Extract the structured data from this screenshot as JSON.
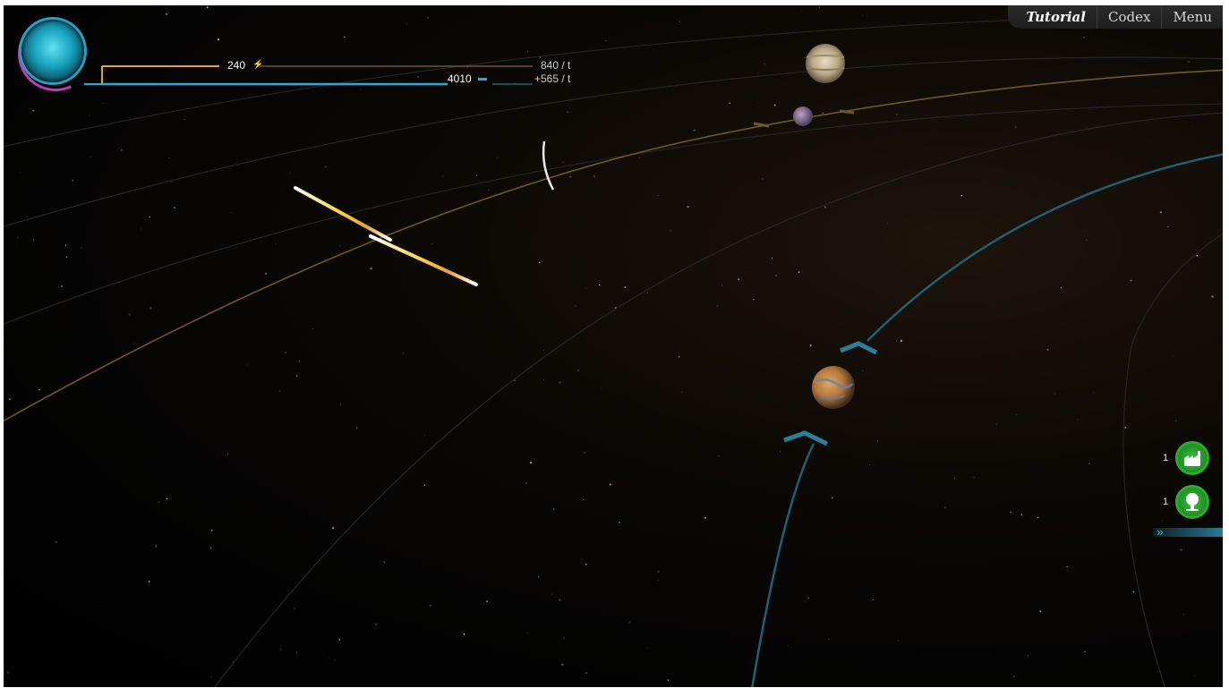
{
  "menu": {
    "tutorial": "Tutorial",
    "codex": "Codex",
    "menu": "Menu"
  },
  "resources": {
    "energy": {
      "value": "240",
      "rate": "840 / t",
      "color": "#e3a33a"
    },
    "science": {
      "value": "4010",
      "rate": "+565 / t",
      "color": "#2aa9d6"
    }
  },
  "counters": [
    {
      "count": "1",
      "icon": "factory-icon"
    },
    {
      "count": "1",
      "icon": "tree-icon"
    }
  ],
  "icons": {
    "avatar": "planet-avatar-icon",
    "energy": "lightning-icon",
    "science": "science-icon",
    "side_panel": "chevron-right-icon"
  },
  "colors": {
    "orbit_gold": "#6b5a23",
    "orbit_blue": "#1f5f78",
    "orbit_gray": "#2a2a2a",
    "accent_green": "#2eaa30"
  }
}
